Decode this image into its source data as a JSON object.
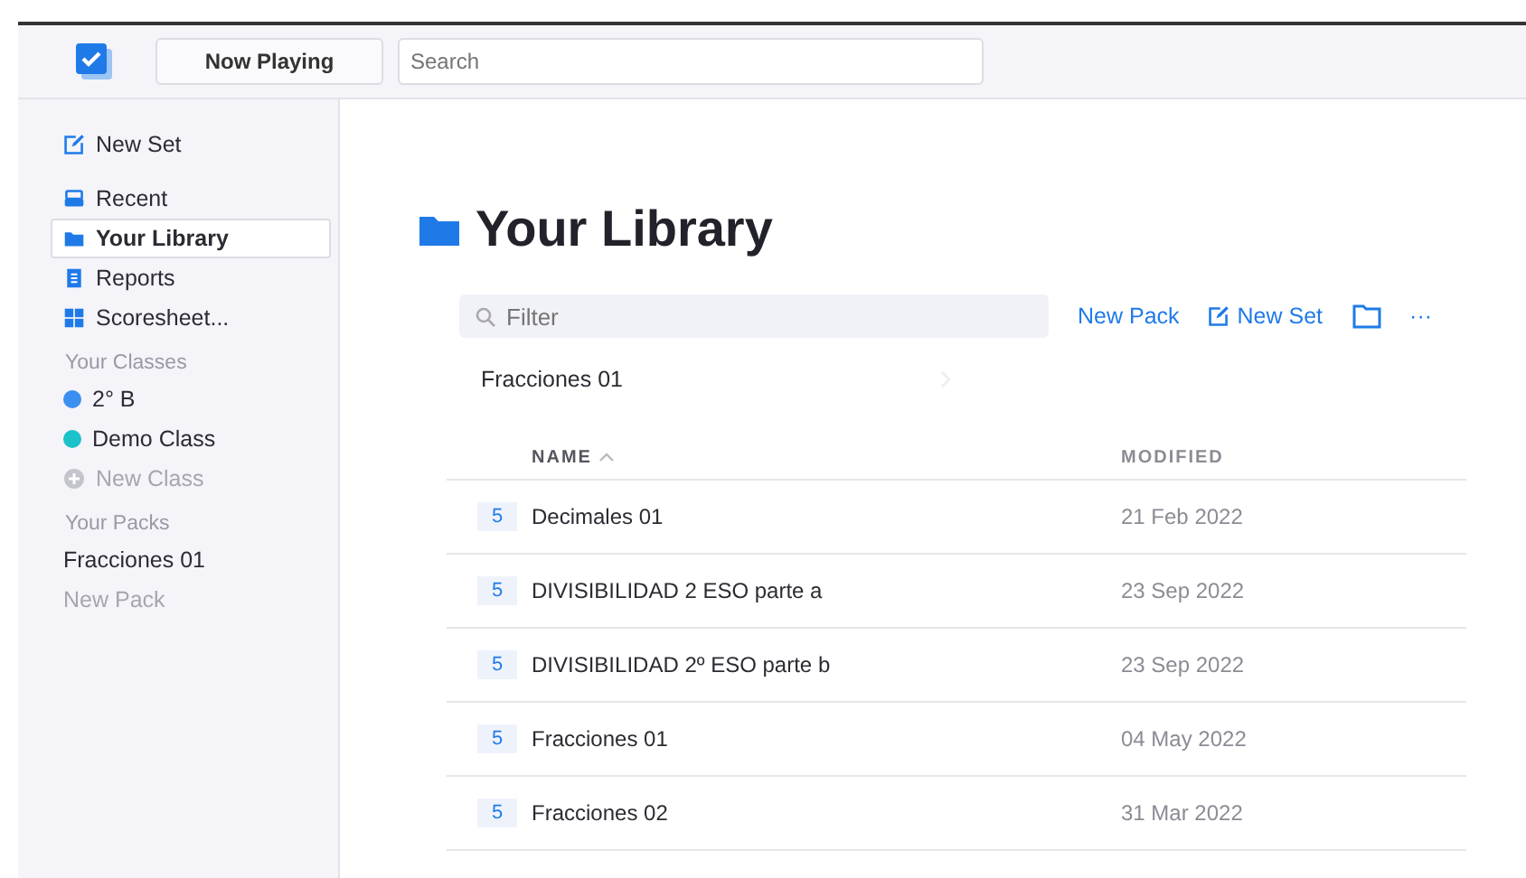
{
  "toolbar": {
    "now_playing": "Now Playing",
    "search": {
      "placeholder": "Search"
    }
  },
  "sidebar": {
    "new_set": "New Set",
    "items": [
      {
        "label": "Recent",
        "kind": "recent",
        "selected": false
      },
      {
        "label": "Your Library",
        "kind": "library",
        "selected": true
      },
      {
        "label": "Reports",
        "kind": "reports",
        "selected": false
      },
      {
        "label": "Scoresheet...",
        "kind": "scoresheet",
        "selected": false
      }
    ],
    "classes_heading": "Your Classes",
    "classes": [
      {
        "label": "2° B",
        "color": "#3b8ff0",
        "disabled": false
      },
      {
        "label": "Demo Class",
        "color": "#1cc2c9",
        "disabled": false
      },
      {
        "label": "New Class",
        "disabled": true
      }
    ],
    "packs_heading": "Your Packs",
    "packs": [
      {
        "label": "Fracciones 01",
        "disabled": false
      },
      {
        "label": "New Pack",
        "disabled": true
      }
    ]
  },
  "main": {
    "title": "Your Library",
    "filter": {
      "placeholder": "Filter"
    },
    "actions": {
      "new_pack": "New Pack",
      "new_set": "New Set",
      "more": "···"
    },
    "breadcrumb": "Fracciones 01",
    "table": {
      "columns": [
        "NAME",
        "MODIFIED"
      ],
      "rows": [
        {
          "count": "5",
          "name": "Decimales 01",
          "modified": "21 Feb 2022"
        },
        {
          "count": "5",
          "name": "DIVISIBILIDAD 2 ESO parte a",
          "modified": "23 Sep 2022"
        },
        {
          "count": "5",
          "name": "DIVISIBILIDAD 2º ESO parte b",
          "modified": "23 Sep 2022"
        },
        {
          "count": "5",
          "name": "Fracciones 01",
          "modified": "04 May 2022"
        },
        {
          "count": "5",
          "name": "Fracciones 02",
          "modified": "31 Mar 2022"
        }
      ]
    }
  }
}
